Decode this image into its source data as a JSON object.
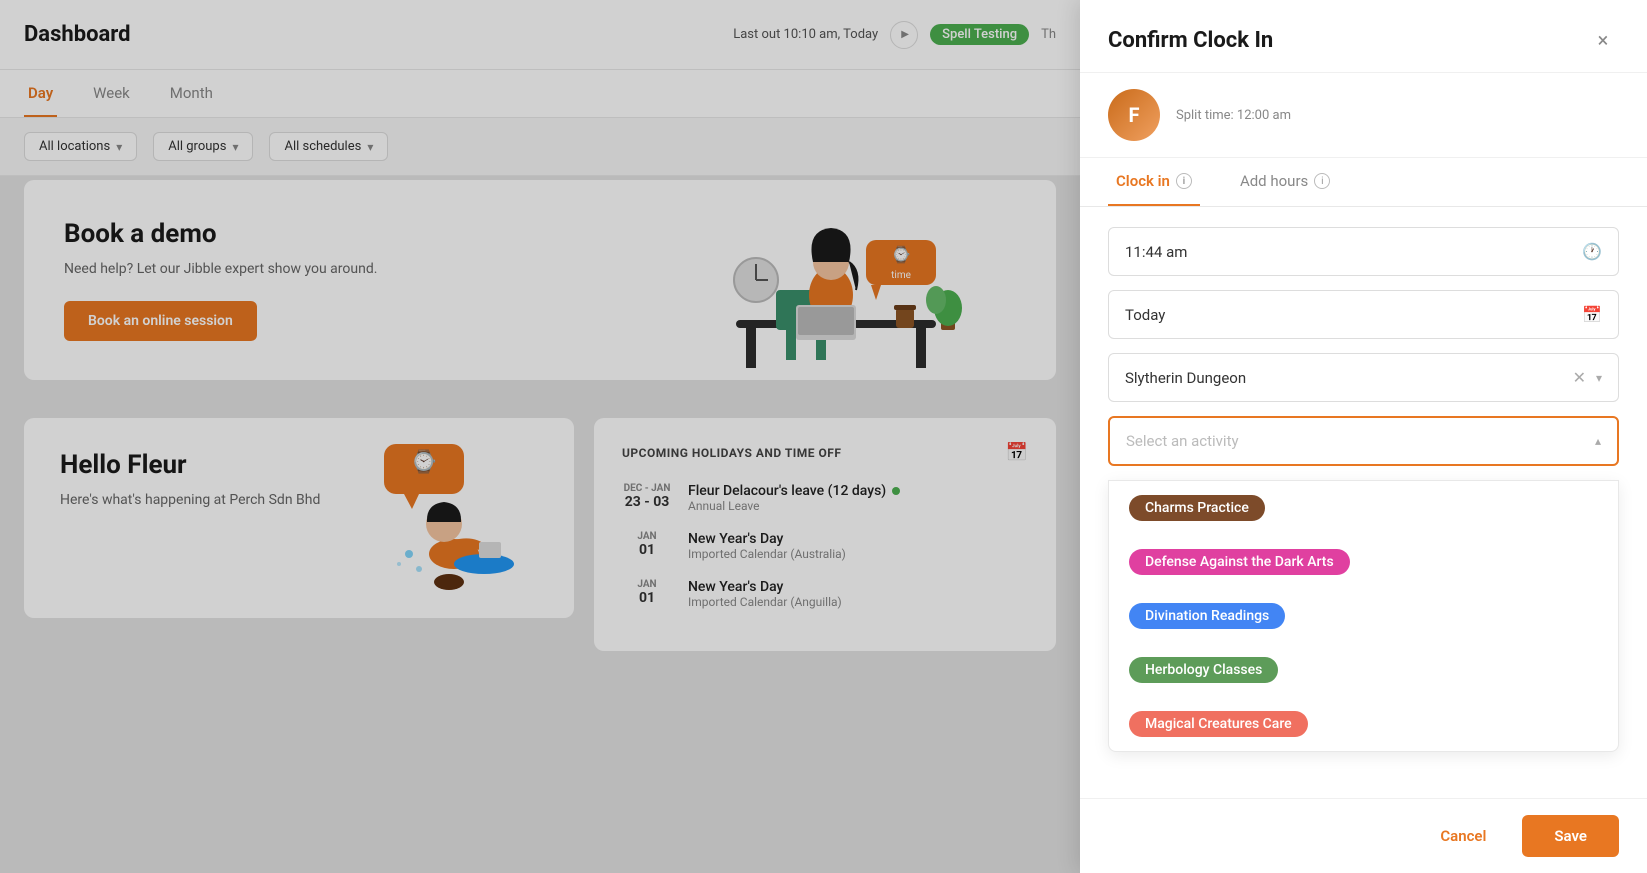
{
  "dashboard": {
    "title": "Dashboard",
    "last_out": "Last out 10:10 am, Today",
    "active_badge": "Spell Testing",
    "header_right": "Th",
    "tabs": [
      {
        "id": "day",
        "label": "Day",
        "active": true
      },
      {
        "id": "week",
        "label": "Week",
        "active": false
      },
      {
        "id": "month",
        "label": "Month",
        "active": false
      }
    ],
    "filters": [
      {
        "id": "locations",
        "label": "All locations"
      },
      {
        "id": "groups",
        "label": "All groups"
      },
      {
        "id": "schedules",
        "label": "All schedules"
      }
    ]
  },
  "demo_card": {
    "title": "Book a demo",
    "subtitle": "Need help? Let our Jibble expert show you around.",
    "button_label": "Book an online session"
  },
  "hello_card": {
    "title": "Hello Fleur",
    "subtitle": "Here's what's happening at Perch Sdn Bhd"
  },
  "holidays_card": {
    "title": "UPCOMING HOLIDAYS AND TIME OFF",
    "items": [
      {
        "date_range": "DEC - JAN",
        "date_nums": "23 - 03",
        "name": "Fleur Delacour's leave (12 days)",
        "type": "Annual Leave",
        "dot": true
      },
      {
        "date_range": "JAN",
        "date_nums": "01",
        "name": "New Year's Day",
        "type": "Imported Calendar (Australia)",
        "dot": false
      },
      {
        "date_range": "JAN",
        "date_nums": "01",
        "name": "New Year's Day",
        "type": "Imported Calendar (Anguilla)",
        "dot": false
      }
    ]
  },
  "modal": {
    "title": "Confirm Clock In",
    "close_label": "×",
    "avatar_split_time": "Split time: 12:00 am",
    "tabs": [
      {
        "id": "clock-in",
        "label": "Clock in",
        "active": true
      },
      {
        "id": "add-hours",
        "label": "Add hours",
        "active": false
      }
    ],
    "time_value": "11:44 am",
    "date_value": "Today",
    "location_value": "Slytherin Dungeon",
    "activity_placeholder": "Select an activity",
    "activities": [
      {
        "id": "charms",
        "label": "Charms Practice",
        "chip_class": "chip-brown"
      },
      {
        "id": "defense",
        "label": "Defense Against the Dark Arts",
        "chip_class": "chip-pink"
      },
      {
        "id": "divination",
        "label": "Divination Readings",
        "chip_class": "chip-blue"
      },
      {
        "id": "herbology",
        "label": "Herbology Classes",
        "chip_class": "chip-green"
      },
      {
        "id": "creatures",
        "label": "Magical Creatures Care",
        "chip_class": "chip-salmon"
      }
    ],
    "cancel_label": "Cancel",
    "save_label": "Save"
  }
}
